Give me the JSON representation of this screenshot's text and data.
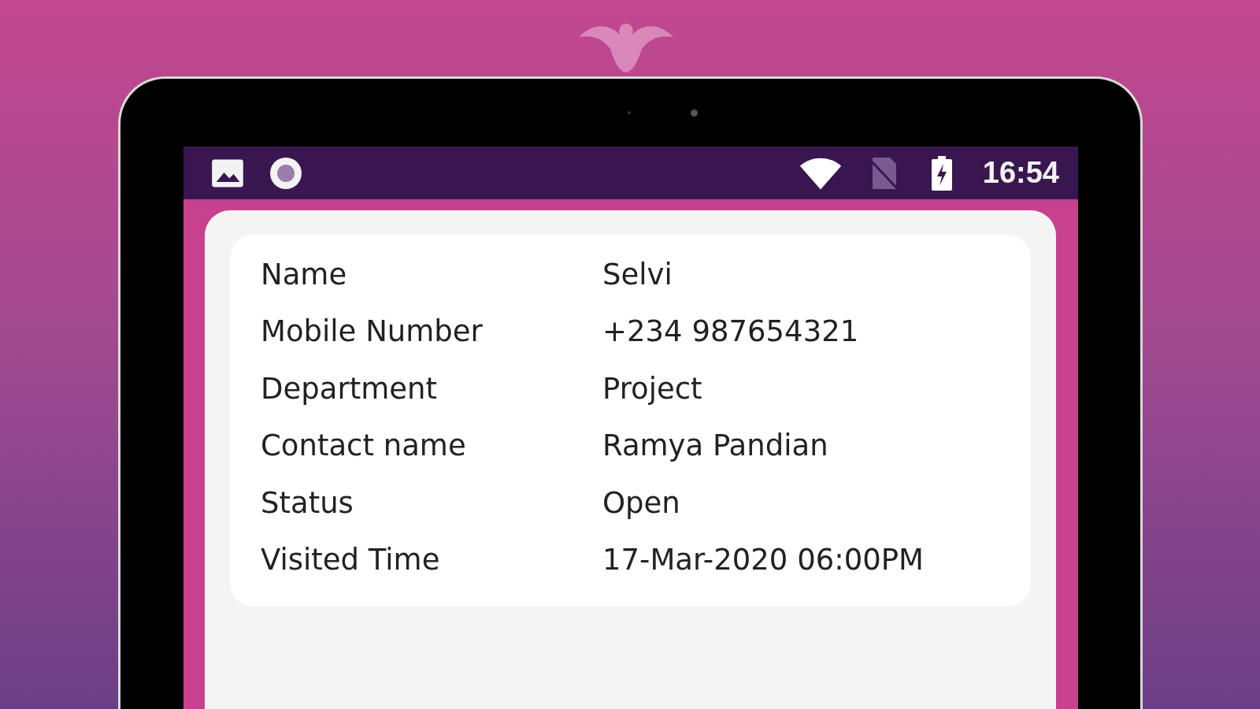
{
  "status_bar": {
    "time": "16:54"
  },
  "details": [
    {
      "label": "Name",
      "value": "Selvi"
    },
    {
      "label": "Mobile Number",
      "value": "+234 987654321"
    },
    {
      "label": "Department",
      "value": "Project"
    },
    {
      "label": "Contact name",
      "value": "Ramya Pandian"
    },
    {
      "label": "Status",
      "value": "Open"
    },
    {
      "label": "Visited Time",
      "value": "17-Mar-2020 06:00PM"
    }
  ]
}
